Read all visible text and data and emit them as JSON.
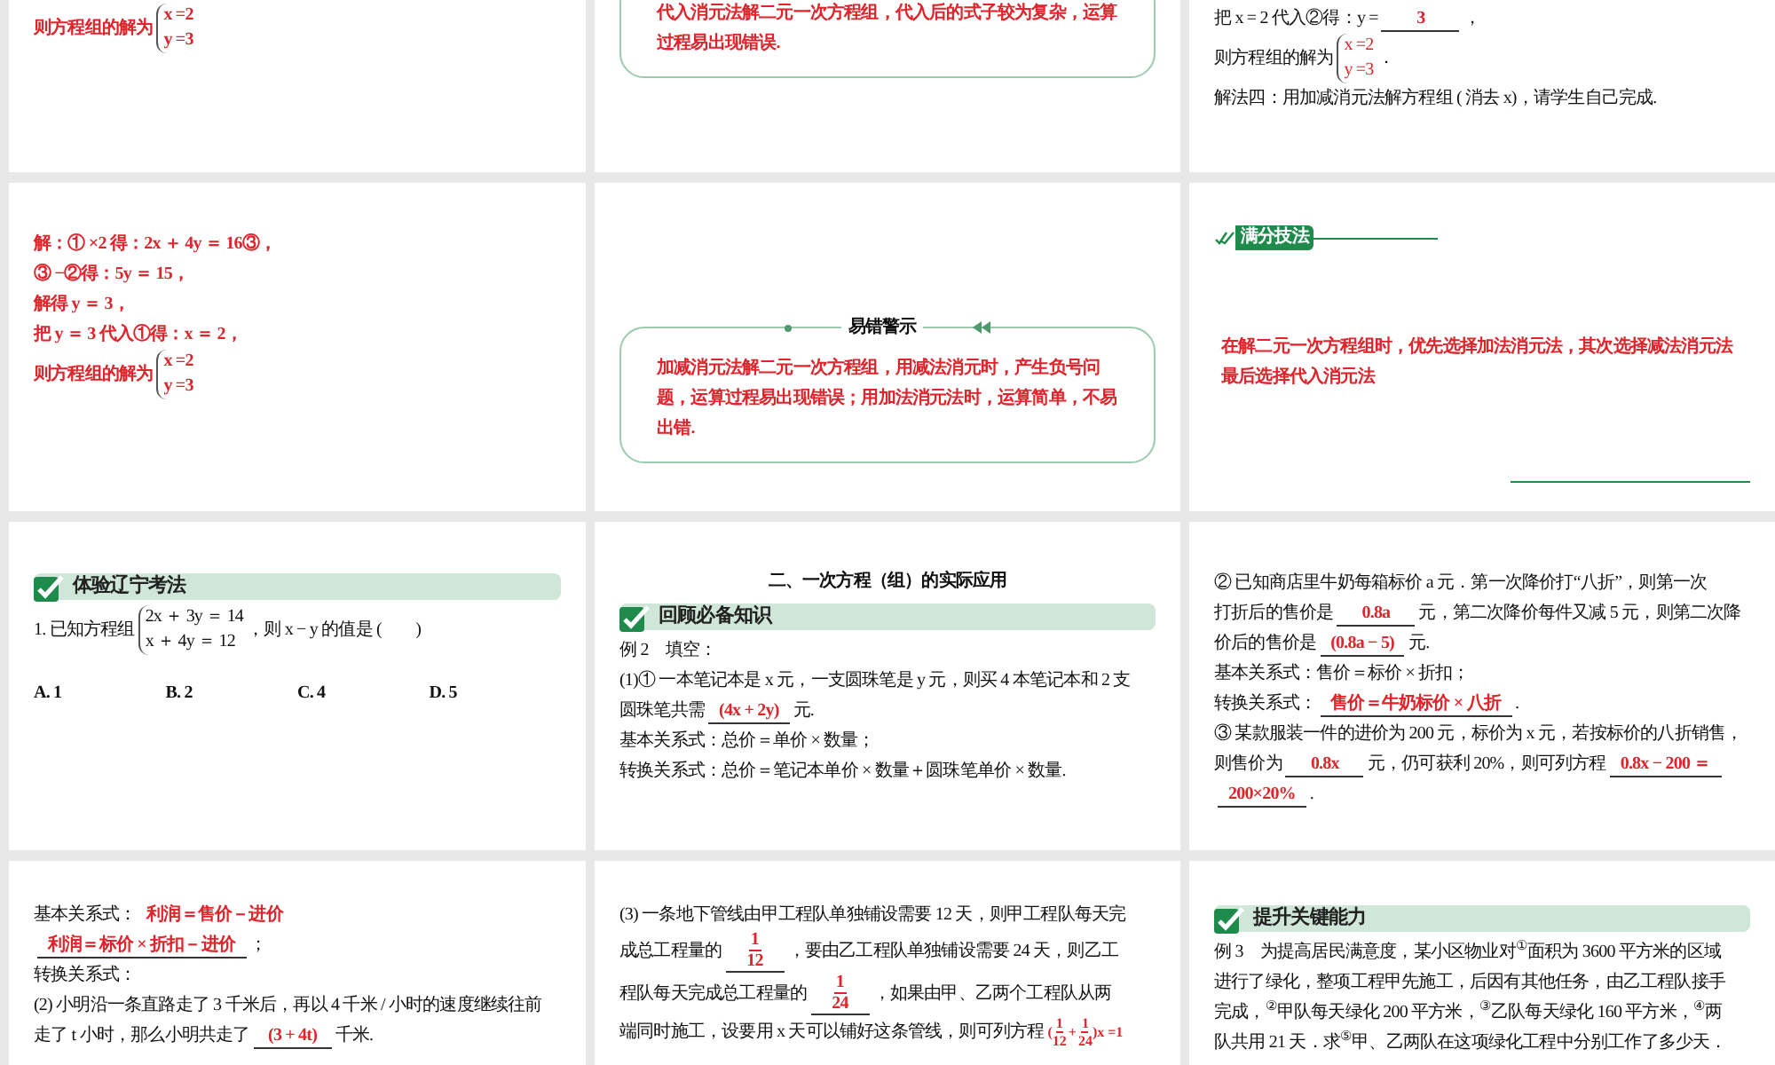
{
  "slides": [
    {
      "blocks": [
        {
          "kind": "red_para",
          "parts": [
            {
              "kind": "text",
              "text": "则方程组的解为"
            },
            {
              "kind": "system",
              "lines": [
                "x =2",
                "y =3"
              ]
            }
          ]
        }
      ]
    },
    {
      "blocks": [
        {
          "kind": "callout",
          "text": "代入消元法解二元一次方程组，代入后的式子较为复杂，运算过程易出现错误."
        }
      ]
    },
    {
      "blocks": [
        {
          "kind": "para",
          "parts": [
            {
              "kind": "text",
              "text": "把 x = 2 代入②得：y ="
            },
            {
              "kind": "answer",
              "text": "3"
            },
            {
              "kind": "text",
              "text": "，"
            }
          ]
        },
        {
          "kind": "para",
          "parts": [
            {
              "kind": "text",
              "text": "则方程组的解为"
            },
            {
              "kind": "system",
              "lines": [
                "x =2",
                "y =3"
              ]
            },
            {
              "kind": "text",
              "text": "．"
            }
          ]
        },
        {
          "kind": "para",
          "parts": [
            {
              "kind": "text",
              "text": "解法四：用加减消元法解方程组 ( 消去 x)，请学生自己完成."
            }
          ]
        }
      ]
    },
    {
      "blocks": [
        {
          "kind": "red_para",
          "parts": [
            {
              "kind": "text",
              "text": "解：① ×2 得：2x ＋ 4y ＝ 16③，"
            }
          ]
        },
        {
          "kind": "red_para",
          "parts": [
            {
              "kind": "text",
              "text": "③ −②得：5y ＝ 15，"
            }
          ]
        },
        {
          "kind": "red_para",
          "parts": [
            {
              "kind": "text",
              "text": "解得 y ＝ 3，"
            }
          ]
        },
        {
          "kind": "red_para",
          "parts": [
            {
              "kind": "text",
              "text": "把 y ＝ 3 代入①得：x ＝ 2，"
            }
          ]
        },
        {
          "kind": "red_para",
          "parts": [
            {
              "kind": "text",
              "text": "则方程组的解为"
            },
            {
              "kind": "system",
              "lines": [
                "x =2",
                "y =3"
              ]
            }
          ]
        }
      ]
    },
    {
      "blocks": [
        {
          "kind": "callout",
          "title": "易错警示",
          "text": "加减消元法解二元一次方程组，用减法消元时，产生负号问题，运算过程易出现错误；用加法消元法时，运算简单，不易出错."
        }
      ]
    },
    {
      "blocks": [
        {
          "kind": "tag",
          "text": "满分技法"
        },
        {
          "kind": "red_para",
          "parts": [
            {
              "kind": "text",
              "text": "在解二元一次方程组时，优先选择加法消元法，其次选择减法消元法最后选择代入消元法"
            }
          ]
        },
        {
          "kind": "footer_rule"
        }
      ]
    },
    {
      "blocks": [
        {
          "kind": "banner",
          "text": "体验辽宁考法"
        },
        {
          "kind": "para",
          "parts": [
            {
              "kind": "text",
              "text": "1. 已知方程组"
            },
            {
              "kind": "plain_system",
              "lines": [
                "2x ＋ 3y ＝ 14",
                "x ＋ 4y ＝ 12"
              ]
            },
            {
              "kind": "text",
              "text": "，则 x − y 的值是 (　　)"
            }
          ]
        },
        {
          "kind": "options",
          "items": [
            "A. 1",
            "B. 2",
            "C. 4",
            "D. 5"
          ]
        }
      ]
    },
    {
      "blocks": [
        {
          "kind": "title",
          "text": "二、一次方程（组）的实际应用"
        },
        {
          "kind": "banner",
          "text": "回顾必备知识"
        },
        {
          "kind": "para",
          "parts": [
            {
              "kind": "text",
              "text": "例 2　填空："
            }
          ]
        },
        {
          "kind": "para",
          "parts": [
            {
              "kind": "text",
              "text": "(1)① 一本笔记本是 x 元，一支圆珠笔是 y 元，则买 4 本笔记本和 2 支"
            }
          ]
        },
        {
          "kind": "para",
          "parts": [
            {
              "kind": "text",
              "text": "圆珠笔共需"
            },
            {
              "kind": "answer",
              "text": "(4x + 2y)"
            },
            {
              "kind": "text",
              "text": "元."
            }
          ]
        },
        {
          "kind": "para",
          "parts": [
            {
              "kind": "text",
              "text": "基本关系式：总价＝单价 × 数量；"
            }
          ]
        },
        {
          "kind": "para",
          "parts": [
            {
              "kind": "text",
              "text": "转换关系式：总价＝笔记本单价 × 数量＋圆珠笔单价 × 数量."
            }
          ]
        }
      ]
    },
    {
      "blocks": [
        {
          "kind": "para",
          "parts": [
            {
              "kind": "text",
              "text": "② 已知商店里牛奶每箱标价 a 元．第一次降价打“八折”，则第一次"
            }
          ]
        },
        {
          "kind": "para",
          "parts": [
            {
              "kind": "text",
              "text": "打折后的售价是"
            },
            {
              "kind": "answer",
              "text": "0.8a"
            },
            {
              "kind": "text",
              "text": "元，第二次降价每件又减 5 元，则第二次降"
            }
          ]
        },
        {
          "kind": "para",
          "parts": [
            {
              "kind": "text",
              "text": "价后的售价是"
            },
            {
              "kind": "answer",
              "text": "(0.8a − 5)"
            },
            {
              "kind": "text",
              "text": "元."
            }
          ]
        },
        {
          "kind": "para",
          "parts": [
            {
              "kind": "text",
              "text": "基本关系式：售价＝标价 × 折扣；"
            }
          ]
        },
        {
          "kind": "para",
          "parts": [
            {
              "kind": "text",
              "text": "转换关系式："
            },
            {
              "kind": "answer",
              "text": "售价＝牛奶标价 × 八折"
            },
            {
              "kind": "text",
              "text": "."
            }
          ]
        },
        {
          "kind": "para",
          "parts": [
            {
              "kind": "text",
              "text": "③ 某款服装一件的进价为 200 元，标价为 x 元，若按标价的八折销售，"
            }
          ]
        },
        {
          "kind": "para",
          "parts": [
            {
              "kind": "text",
              "text": "则售价为"
            },
            {
              "kind": "answer",
              "text": "0.8x"
            },
            {
              "kind": "text",
              "text": "元，仍可获利 20%，则可列方程"
            },
            {
              "kind": "answer",
              "text": "0.8x − 200 ＝"
            }
          ]
        },
        {
          "kind": "para",
          "parts": [
            {
              "kind": "answer",
              "text": "200×20%"
            },
            {
              "kind": "text",
              "text": "."
            }
          ]
        }
      ]
    },
    {
      "blocks": [
        {
          "kind": "para",
          "parts": [
            {
              "kind": "text",
              "text": "基本关系式："
            },
            {
              "kind": "red",
              "text": "利润＝售价－进价"
            }
          ]
        },
        {
          "kind": "para",
          "parts": [
            {
              "kind": "answer",
              "text": "利润＝标价 × 折扣－进价"
            },
            {
              "kind": "text",
              "text": "；"
            }
          ]
        },
        {
          "kind": "para",
          "parts": [
            {
              "kind": "text",
              "text": "转换关系式："
            }
          ]
        },
        {
          "kind": "para",
          "parts": [
            {
              "kind": "text",
              "text": "(2) 小明沿一条直路走了 3 千米后，再以 4 千米 / 小时的速度继续往前"
            }
          ]
        },
        {
          "kind": "para",
          "parts": [
            {
              "kind": "text",
              "text": "走了 t 小时，那么小明共走了"
            },
            {
              "kind": "answer",
              "text": "(3 + 4t)"
            },
            {
              "kind": "text",
              "text": "千米."
            }
          ]
        }
      ]
    },
    {
      "blocks": [
        {
          "kind": "para",
          "parts": [
            {
              "kind": "text",
              "text": "(3) 一条地下管线由甲工程队单独铺设需要 12 天，则甲工程队每天完"
            }
          ]
        },
        {
          "kind": "para",
          "parts": [
            {
              "kind": "text",
              "text": "成总工程量的"
            },
            {
              "kind": "fraction",
              "num": "1",
              "den": "12"
            },
            {
              "kind": "text",
              "text": "，要由乙工程队单独铺设需要 24 天，则乙工"
            }
          ]
        },
        {
          "kind": "para",
          "parts": [
            {
              "kind": "text",
              "text": "程队每天完成总工程量的"
            },
            {
              "kind": "fraction",
              "num": "1",
              "den": "24"
            },
            {
              "kind": "text",
              "text": "，如果由甲、乙两个工程队从两"
            }
          ]
        },
        {
          "kind": "para",
          "parts": [
            {
              "kind": "text",
              "text": "端同时施工，设要用 x 天可以铺好这条管线，则可列方程"
            },
            {
              "kind": "frac_equation",
              "open": "(",
              "op": "+",
              "close": ")x =1",
              "terms": [
                {
                  "num": "1",
                  "den": "12"
                },
                {
                  "num": "1",
                  "den": "24"
                }
              ]
            }
          ]
        }
      ]
    },
    {
      "blocks": [
        {
          "kind": "banner",
          "text": "提升关键能力"
        },
        {
          "kind": "para",
          "parts": [
            {
              "kind": "text",
              "text": "例 3　为提高居民满意度，某小区物业对$^{①}$面积为 3600 平方米的区域"
            }
          ]
        },
        {
          "kind": "para",
          "parts": [
            {
              "kind": "text",
              "text": "进行了绿化，整项工程甲先施工，后因有其他任务，由乙工程队接手"
            }
          ]
        },
        {
          "kind": "para",
          "parts": [
            {
              "kind": "text",
              "text": "完成，$^{②}$甲队每天绿化 200 平方米，$^{③}$乙队每天绿化 160 平方米，$^{④}$两"
            }
          ]
        },
        {
          "kind": "para",
          "parts": [
            {
              "kind": "text",
              "text": "队共用 21 天．求$^{⑤}$甲、乙两队在这项绿化工程中分别工作了多少天．"
            }
          ]
        }
      ]
    }
  ]
}
